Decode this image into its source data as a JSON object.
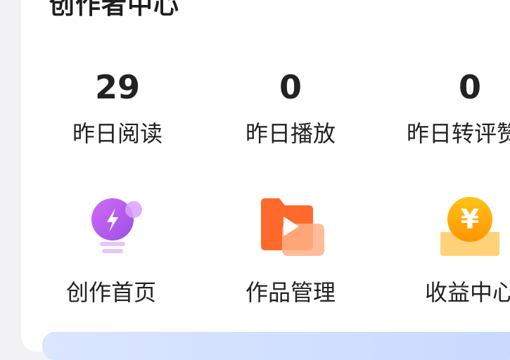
{
  "header": {
    "title": "创作者中心"
  },
  "stats": [
    {
      "value": "29",
      "label": "昨日阅读"
    },
    {
      "value": "0",
      "label": "昨日播放"
    },
    {
      "value": "0",
      "label": "昨日转评赞"
    }
  ],
  "tools": [
    {
      "label": "创作首页",
      "icon": "lightbulb-icon"
    },
    {
      "label": "作品管理",
      "icon": "video-folder-icon"
    },
    {
      "label": "收益中心",
      "icon": "yuan-coin-icon"
    }
  ],
  "icons": {
    "yuan_symbol": "¥"
  },
  "colors": {
    "bulb": "#b45cf0",
    "folder": "#ff6a2b",
    "coin": "#ffa800"
  }
}
